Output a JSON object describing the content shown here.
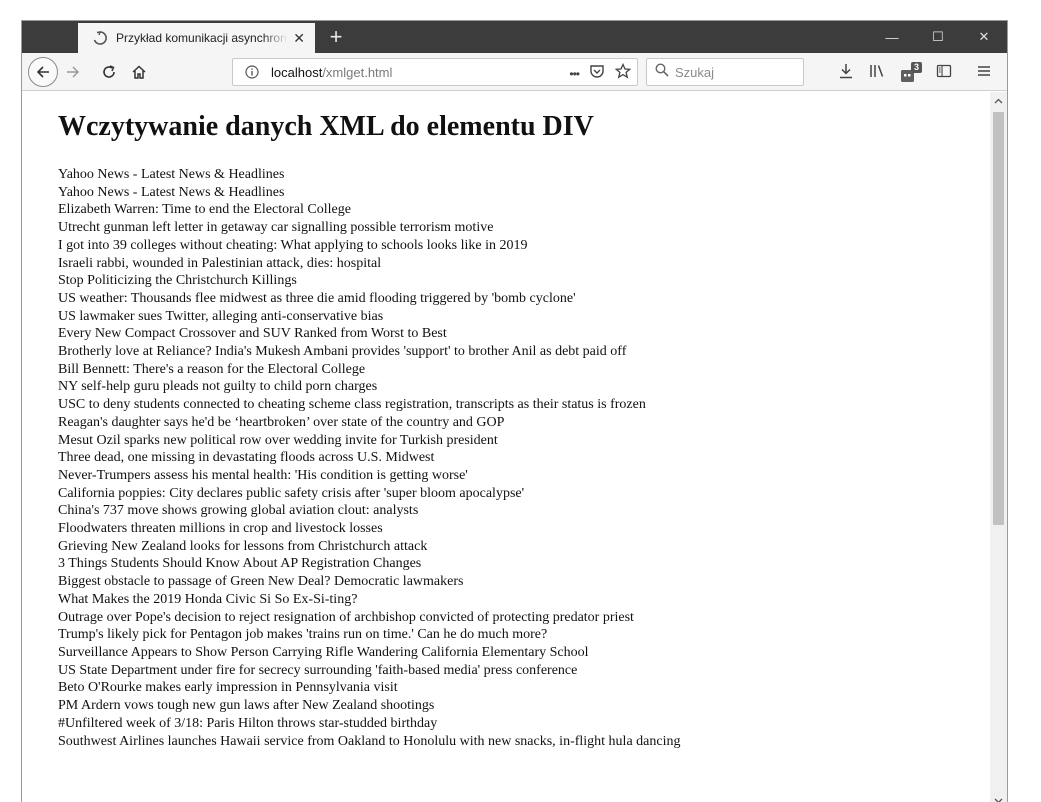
{
  "browser": {
    "tab": {
      "title": "Przykład komunikacji asynchronicznej",
      "close": "✕"
    },
    "new_tab": "+",
    "window_controls": {
      "minimize": "—",
      "maximize": "☐",
      "close": "✕"
    },
    "url": {
      "host": "localhost",
      "path": "/xmlget.html"
    },
    "url_more": "•••",
    "search_placeholder": "Szukaj",
    "extension_badge": "3"
  },
  "page": {
    "title": "Wczytywanie danych XML do elementu DIV",
    "headlines": [
      "Yahoo News - Latest News & Headlines",
      "Yahoo News - Latest News & Headlines",
      "Elizabeth Warren: Time to end the Electoral College",
      "Utrecht gunman left letter in getaway car signalling possible terrorism motive",
      "I got into 39 colleges without cheating: What applying to schools looks like in 2019",
      "Israeli rabbi, wounded in Palestinian attack, dies: hospital",
      "Stop Politicizing the Christchurch Killings",
      "US weather: Thousands flee midwest as three die amid flooding triggered by 'bomb cyclone'",
      "US lawmaker sues Twitter, alleging anti-conservative bias",
      "Every New Compact Crossover and SUV Ranked from Worst to Best",
      "Brotherly love at Reliance? India's Mukesh Ambani provides 'support' to brother Anil as debt paid off",
      "Bill Bennett: There's a reason for the Electoral College",
      "NY self-help guru pleads not guilty to child porn charges",
      "USC to deny students connected to cheating scheme class registration, transcripts as their status is frozen",
      "Reagan's daughter says he'd be ‘heartbroken’ over state of the country and GOP",
      "Mesut Ozil sparks new political row over wedding invite for Turkish president",
      "Three dead, one missing in devastating floods across U.S. Midwest",
      "Never-Trumpers assess his mental health: 'His condition is getting worse'",
      "California poppies: City declares public safety crisis after 'super bloom apocalypse'",
      "China's 737 move shows growing global aviation clout: analysts",
      "Floodwaters threaten millions in crop and livestock losses",
      "Grieving New Zealand looks for lessons from Christchurch attack",
      "3 Things Students Should Know About AP Registration Changes",
      "Biggest obstacle to passage of Green New Deal? Democratic lawmakers",
      "What Makes the 2019 Honda Civic Si So Ex-Si-ting?",
      "Outrage over Pope's decision to reject resignation of archbishop convicted of protecting predator priest",
      "Trump's likely pick for Pentagon job makes 'trains run on time.' Can he do much more?",
      "Surveillance Appears to Show Person Carrying Rifle Wandering California Elementary School",
      "US State Department under fire for secrecy surrounding 'faith-based media' press conference",
      "Beto O'Rourke makes early impression in Pennsylvania visit",
      "PM Ardern vows tough new gun laws after New Zealand shootings",
      "#Unfiltered week of 3/18: Paris Hilton throws star-studded birthday",
      "Southwest Airlines launches Hawaii service from Oakland to Honolulu with new snacks, in-flight hula dancing"
    ]
  }
}
